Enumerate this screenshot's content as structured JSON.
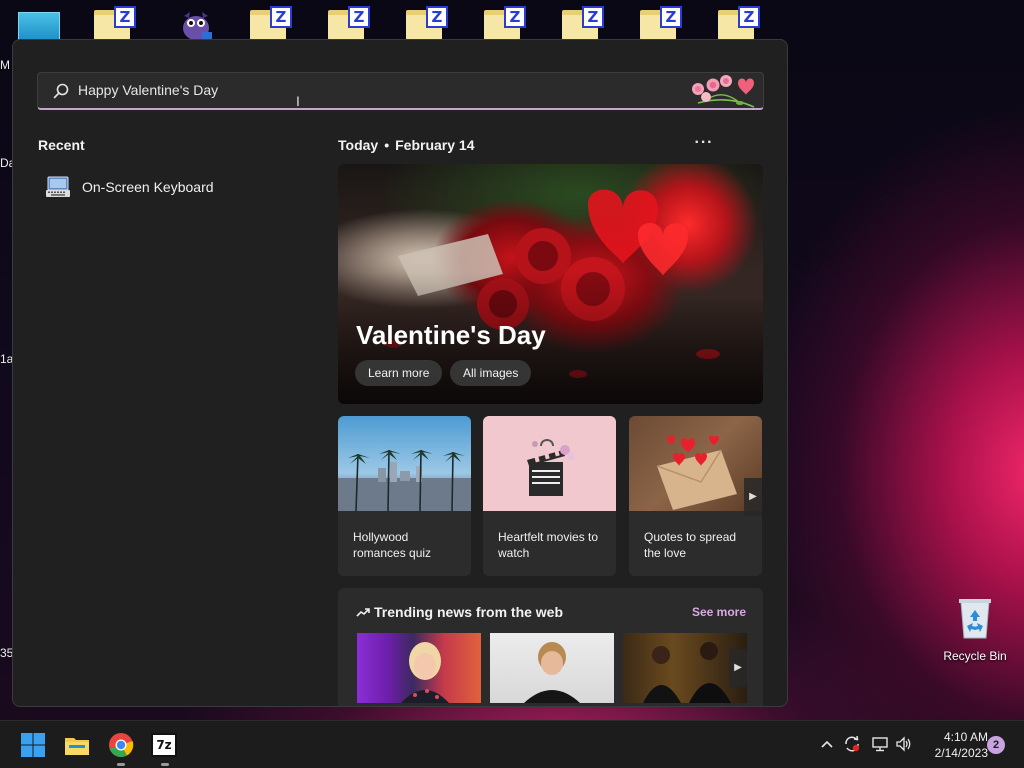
{
  "desktop": {
    "folder_badge": "Z",
    "edge_labels": [
      "M",
      "Da",
      "1a",
      "35"
    ],
    "recycle_bin_label": "Recycle Bin"
  },
  "start_menu": {
    "search": {
      "value": "Happy Valentine's Day",
      "placeholder": ""
    },
    "recent": {
      "title": "Recent",
      "items": [
        {
          "label": "On-Screen Keyboard",
          "icon": "keyboard-icon"
        }
      ]
    },
    "highlights": {
      "today_label": "Today",
      "separator": "•",
      "date": "February 14",
      "more": "···",
      "hero": {
        "title": "Valentine's Day",
        "learn_more": "Learn more",
        "all_images": "All images"
      },
      "cards": [
        {
          "label": "Hollywood romances quiz"
        },
        {
          "label": "Heartfelt movies to watch"
        },
        {
          "label": "Quotes to spread the love"
        }
      ],
      "trending": {
        "title": "Trending news from the web",
        "see_more": "See more"
      }
    }
  },
  "taskbar": {
    "seven_zip_label": "7z",
    "time": "4:10 AM",
    "date": "2/14/2023",
    "notifications": "2"
  },
  "colors": {
    "accent": "#c9a3cf",
    "see_more": "#dba9e2",
    "panel_bg": "#202020",
    "taskbar_bg": "#1c1c1c"
  }
}
